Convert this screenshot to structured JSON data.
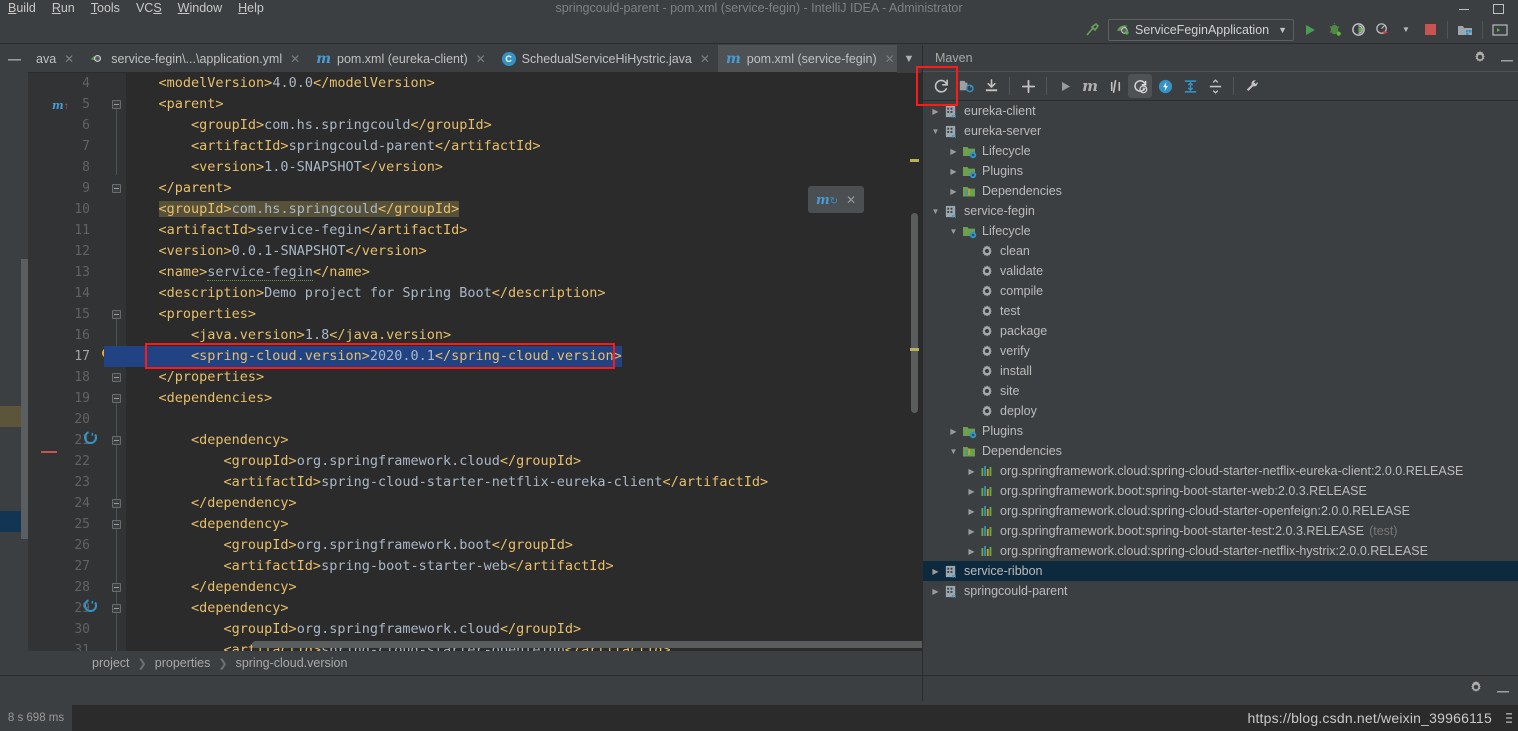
{
  "window": {
    "title": "springcould-parent - pom.xml (service-fegin) - IntelliJ IDEA - Administrator",
    "menu": [
      "Build",
      "Run",
      "Tools",
      "VCS",
      "Window",
      "Help"
    ]
  },
  "toolbar": {
    "run_config": "ServiceFeginApplication",
    "icons": [
      "build-hammer-icon",
      "run-icon",
      "debug-icon",
      "run-with-coverage-icon",
      "profiler-icon",
      "stop-icon",
      "project-structure-icon",
      "select-target-icon"
    ]
  },
  "tabs": [
    {
      "label": "ava",
      "icon": "java-file-icon",
      "active": false
    },
    {
      "label": "service-fegin\\...\\application.yml",
      "icon": "yaml-file-icon",
      "active": false
    },
    {
      "label": "pom.xml (eureka-client)",
      "icon": "maven-file-icon",
      "active": false
    },
    {
      "label": "SchedualServiceHiHystric.java",
      "icon": "java-class-icon",
      "active": false
    },
    {
      "label": "pom.xml (service-fegin)",
      "icon": "maven-file-icon",
      "active": true
    }
  ],
  "editor": {
    "lines": [
      {
        "n": 4,
        "indent": 4,
        "text": "<modelVersion>4.0.0</modelVersion>"
      },
      {
        "n": 5,
        "indent": 4,
        "text": "<parent>"
      },
      {
        "n": 6,
        "indent": 8,
        "text": "<groupId>com.hs.springcould</groupId>"
      },
      {
        "n": 7,
        "indent": 8,
        "text": "<artifactId>springcould-parent</artifactId>"
      },
      {
        "n": 8,
        "indent": 8,
        "text": "<version>1.0-SNAPSHOT</version>"
      },
      {
        "n": 9,
        "indent": 4,
        "text": "</parent>"
      },
      {
        "n": 10,
        "indent": 4,
        "text": "<groupId>com.hs.springcould</groupId>",
        "highlight": "olive"
      },
      {
        "n": 11,
        "indent": 4,
        "text": "<artifactId>service-fegin</artifactId>"
      },
      {
        "n": 12,
        "indent": 4,
        "text": "<version>0.0.1-SNAPSHOT</version>"
      },
      {
        "n": 13,
        "indent": 4,
        "text": "<name>service-fegin</name>"
      },
      {
        "n": 14,
        "indent": 4,
        "text": "<description>Demo project for Spring Boot</description>"
      },
      {
        "n": 15,
        "indent": 4,
        "text": "<properties>"
      },
      {
        "n": 16,
        "indent": 8,
        "text": "<java.version>1.8</java.version>"
      },
      {
        "n": 17,
        "indent": 8,
        "text": "<spring-cloud.version>2020.0.1</spring-cloud.version>",
        "highlight": "selected",
        "current": true
      },
      {
        "n": 18,
        "indent": 4,
        "text": "</properties>"
      },
      {
        "n": 19,
        "indent": 4,
        "text": "<dependencies>"
      },
      {
        "n": 20,
        "indent": 0,
        "text": ""
      },
      {
        "n": 21,
        "indent": 8,
        "text": "<dependency>"
      },
      {
        "n": 22,
        "indent": 12,
        "text": "<groupId>org.springframework.cloud</groupId>"
      },
      {
        "n": 23,
        "indent": 12,
        "text": "<artifactId>spring-cloud-starter-netflix-eureka-client</artifactId>"
      },
      {
        "n": 24,
        "indent": 8,
        "text": "</dependency>"
      },
      {
        "n": 25,
        "indent": 8,
        "text": "<dependency>"
      },
      {
        "n": 26,
        "indent": 12,
        "text": "<groupId>org.springframework.boot</groupId>"
      },
      {
        "n": 27,
        "indent": 12,
        "text": "<artifactId>spring-boot-starter-web</artifactId>"
      },
      {
        "n": 28,
        "indent": 8,
        "text": "</dependency>"
      },
      {
        "n": 29,
        "indent": 8,
        "text": "<dependency>"
      },
      {
        "n": 30,
        "indent": 12,
        "text": "<groupId>org.springframework.cloud</groupId>"
      },
      {
        "n": 31,
        "indent": 12,
        "text": "<artifactId>spring-cloud-starter-openfeign</artifactId>"
      }
    ],
    "breadcrumb": [
      "project",
      "properties",
      "spring-cloud.version"
    ]
  },
  "maven": {
    "title": "Maven",
    "toolbar_icons": [
      "reimport-refresh-icon",
      "generate-sources-icon",
      "download-sources-icon",
      "add-maven-project-icon",
      "run-icon",
      "execute-goal-icon",
      "toggle-offline-icon",
      "toggle-skip-tests-icon",
      "show-dependencies-icon",
      "expand-all-icon",
      "collapse-all-icon",
      "maven-settings-icon"
    ],
    "tree": [
      {
        "depth": 0,
        "label": "eureka-client",
        "icon": "maven-module-icon",
        "state": "collapsed"
      },
      {
        "depth": 0,
        "label": "eureka-server",
        "icon": "maven-module-icon",
        "state": "expanded"
      },
      {
        "depth": 1,
        "label": "Lifecycle",
        "icon": "lifecycle-folder-icon",
        "state": "collapsed"
      },
      {
        "depth": 1,
        "label": "Plugins",
        "icon": "plugins-folder-icon",
        "state": "collapsed"
      },
      {
        "depth": 1,
        "label": "Dependencies",
        "icon": "dependencies-folder-icon",
        "state": "collapsed"
      },
      {
        "depth": 0,
        "label": "service-fegin",
        "icon": "maven-module-icon",
        "state": "expanded"
      },
      {
        "depth": 1,
        "label": "Lifecycle",
        "icon": "lifecycle-folder-icon",
        "state": "expanded"
      },
      {
        "depth": 2,
        "label": "clean",
        "icon": "goal-gear-icon",
        "state": "leaf"
      },
      {
        "depth": 2,
        "label": "validate",
        "icon": "goal-gear-icon",
        "state": "leaf"
      },
      {
        "depth": 2,
        "label": "compile",
        "icon": "goal-gear-icon",
        "state": "leaf"
      },
      {
        "depth": 2,
        "label": "test",
        "icon": "goal-gear-icon",
        "state": "leaf"
      },
      {
        "depth": 2,
        "label": "package",
        "icon": "goal-gear-icon",
        "state": "leaf"
      },
      {
        "depth": 2,
        "label": "verify",
        "icon": "goal-gear-icon",
        "state": "leaf"
      },
      {
        "depth": 2,
        "label": "install",
        "icon": "goal-gear-icon",
        "state": "leaf"
      },
      {
        "depth": 2,
        "label": "site",
        "icon": "goal-gear-icon",
        "state": "leaf"
      },
      {
        "depth": 2,
        "label": "deploy",
        "icon": "goal-gear-icon",
        "state": "leaf"
      },
      {
        "depth": 1,
        "label": "Plugins",
        "icon": "plugins-folder-icon",
        "state": "collapsed"
      },
      {
        "depth": 1,
        "label": "Dependencies",
        "icon": "dependencies-folder-icon",
        "state": "expanded"
      },
      {
        "depth": 2,
        "label": "org.springframework.cloud:spring-cloud-starter-netflix-eureka-client:2.0.0.RELEASE",
        "icon": "dependency-bars-icon",
        "state": "collapsed"
      },
      {
        "depth": 2,
        "label": "org.springframework.boot:spring-boot-starter-web:2.0.3.RELEASE",
        "icon": "dependency-bars-icon",
        "state": "collapsed"
      },
      {
        "depth": 2,
        "label": "org.springframework.cloud:spring-cloud-starter-openfeign:2.0.0.RELEASE",
        "icon": "dependency-bars-icon",
        "state": "collapsed"
      },
      {
        "depth": 2,
        "label": "org.springframework.boot:spring-boot-starter-test:2.0.3.RELEASE",
        "suffix": "(test)",
        "icon": "dependency-bars-icon",
        "state": "collapsed"
      },
      {
        "depth": 2,
        "label": "org.springframework.cloud:spring-cloud-starter-netflix-hystrix:2.0.0.RELEASE",
        "icon": "dependency-bars-icon",
        "state": "collapsed"
      },
      {
        "depth": 0,
        "label": "service-ribbon",
        "icon": "maven-module-icon",
        "state": "collapsed",
        "selected": true
      },
      {
        "depth": 0,
        "label": "springcould-parent",
        "icon": "maven-module-icon",
        "state": "collapsed"
      }
    ]
  },
  "status": {
    "elapsed": "8 s 698 ms",
    "watermark": "https://blog.csdn.net/weixin_39966115"
  },
  "annotations": {
    "box_editor_label": "highlight-line-17-spring-cloud-version",
    "box_maven_label": "highlight-maven-reimport-button"
  },
  "colors": {
    "accent_blue": "#3592c4",
    "selection_blue": "#214283",
    "annotation_red": "#ff1a1a",
    "xml_tag": "#e8bf6a",
    "xml_text": "#a9b7c6",
    "bg_editor": "#2b2b2b",
    "bg_chrome": "#3c3f41"
  }
}
